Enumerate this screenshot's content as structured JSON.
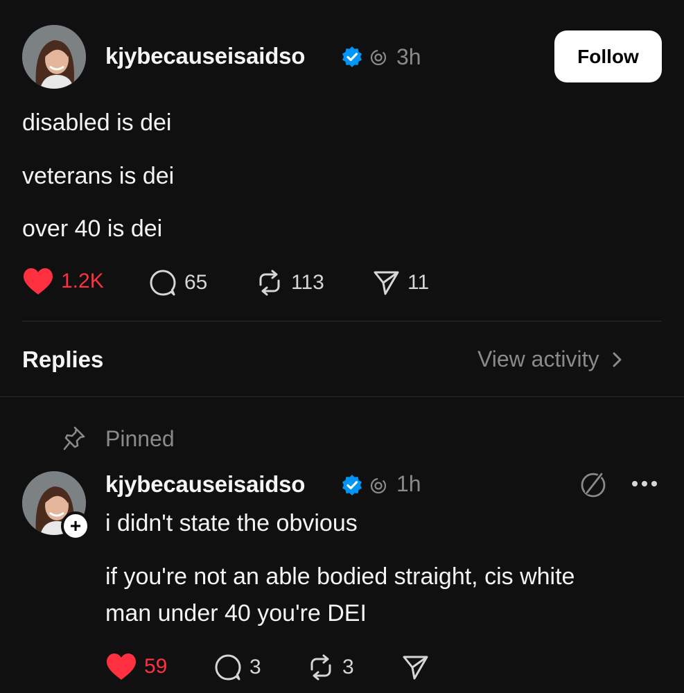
{
  "post": {
    "username": "kjybecauseisaidso",
    "time": "3h",
    "follow_label": "Follow",
    "lines": [
      "disabled is dei",
      "veterans is dei",
      "over 40 is dei"
    ],
    "likes": "1.2K",
    "comments": "65",
    "reposts": "113",
    "shares": "11"
  },
  "replies_header": {
    "title": "Replies",
    "view_activity": "View activity"
  },
  "pinned_label": "Pinned",
  "reply": {
    "username": "kjybecauseisaidso",
    "time": "1h",
    "lines": [
      "i didn't state the obvious",
      "if you're not an able bodied straight, cis white",
      "man under 40 you're DEI"
    ],
    "likes": "59",
    "comments": "3",
    "reposts": "3"
  },
  "colors": {
    "background": "#101010",
    "like_red": "#ff3040",
    "verified_blue": "#0095f6",
    "muted": "#8a8a8a"
  }
}
